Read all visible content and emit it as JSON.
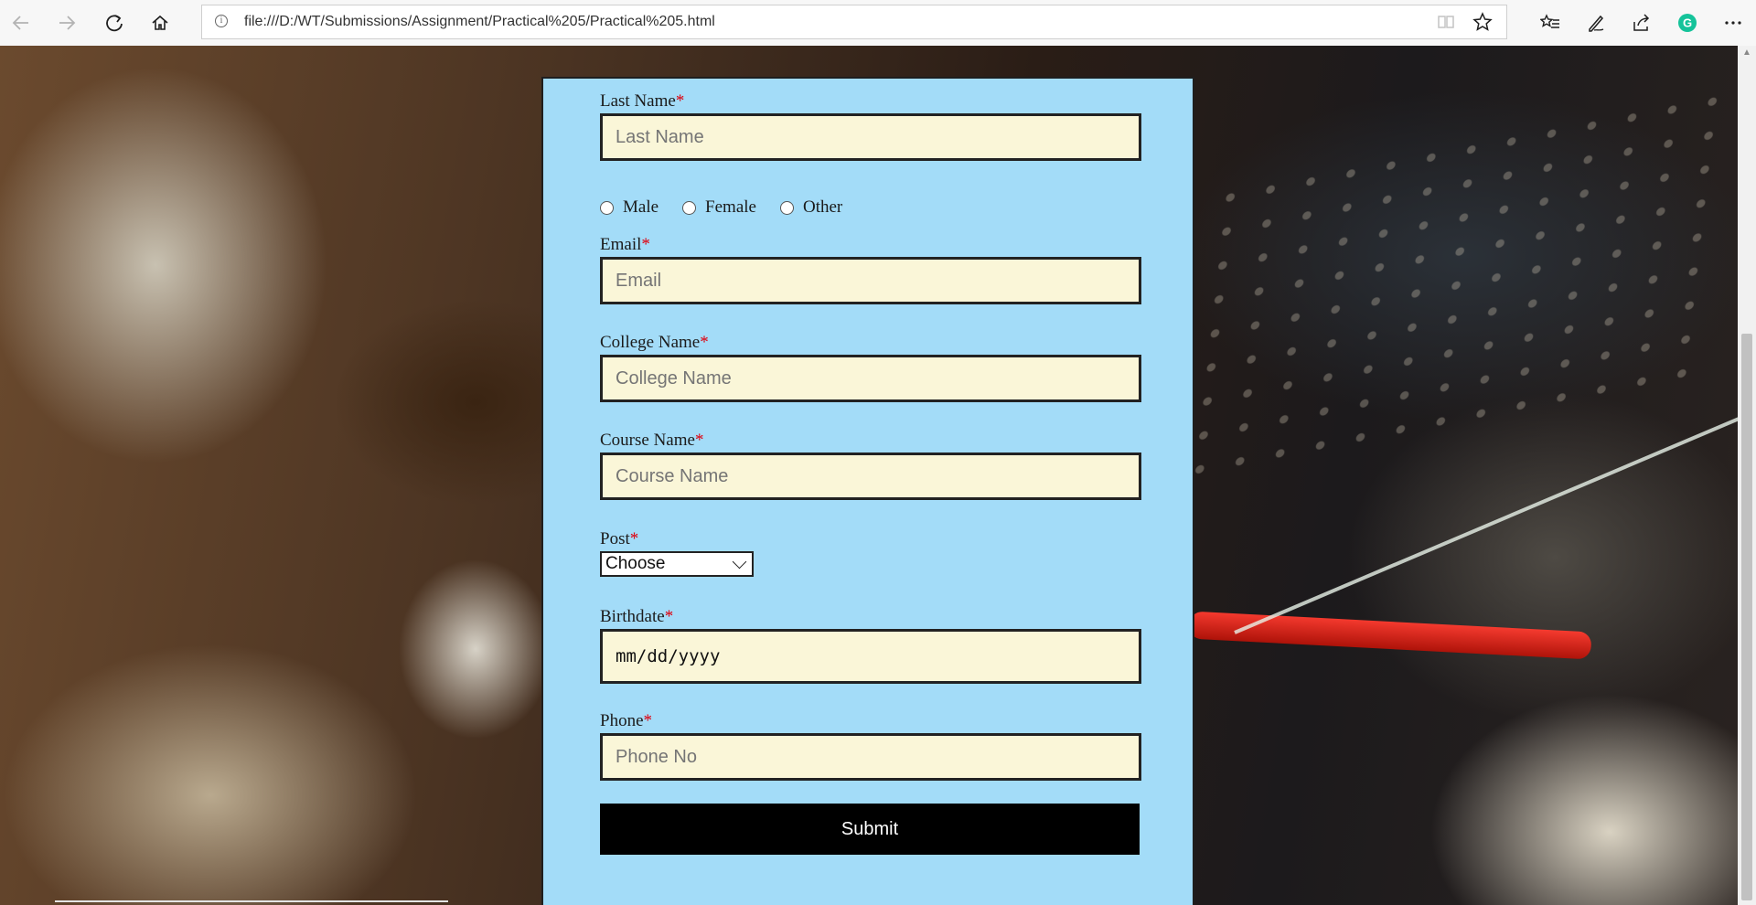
{
  "browser": {
    "url": "file:///D:/WT/Submissions/Assignment/Practical%205/Practical%205.html"
  },
  "form": {
    "last_name": {
      "label": "Last Name",
      "required_mark": "*",
      "placeholder": "Last Name"
    },
    "gender": {
      "options": [
        "Male",
        "Female",
        "Other"
      ]
    },
    "email": {
      "label": "Email",
      "required_mark": "*",
      "placeholder": "Email"
    },
    "college": {
      "label": "College Name",
      "required_mark": "*",
      "placeholder": "College Name"
    },
    "course": {
      "label": "Course Name",
      "required_mark": "*",
      "placeholder": "Course Name"
    },
    "post": {
      "label": "Post",
      "required_mark": "*",
      "selected": "Choose"
    },
    "birthdate": {
      "label": "Birthdate",
      "required_mark": "*",
      "value": "mm/dd/yyyy"
    },
    "phone": {
      "label": "Phone",
      "required_mark": "*",
      "placeholder": "Phone No"
    },
    "submit_label": "Submit"
  },
  "colors": {
    "card_bg": "#a3dcf8",
    "input_bg": "#faf6d8",
    "required": "#e0000d",
    "button_bg": "#000000"
  }
}
